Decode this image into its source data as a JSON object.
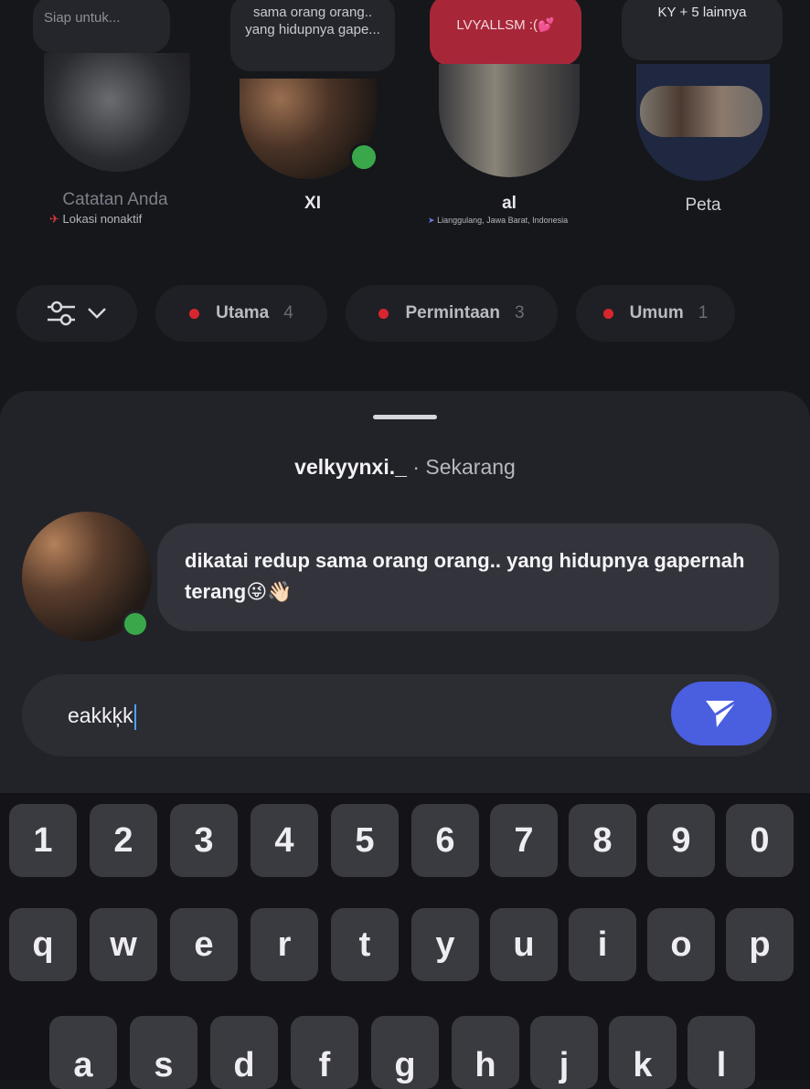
{
  "notes": [
    {
      "bubble": "Siap untuk...",
      "name": "Catatan Anda",
      "sub": "Lokasi nonaktif"
    },
    {
      "bubble": "sama orang orang.. yang hidupnya gape...",
      "name": "XI"
    },
    {
      "bubble": "LVYALLSM :(💕",
      "name": "al",
      "sub": "Lianggulang, Jawa Barat, Indonesia"
    },
    {
      "bubble": "KY + 5 lainnya",
      "name": "Peta"
    }
  ],
  "filters": [
    {
      "label": "Utama",
      "count": "4"
    },
    {
      "label": "Permintaan",
      "count": "3"
    },
    {
      "label": "Umum",
      "count": "1"
    }
  ],
  "sheet": {
    "username": "velkyynxi._",
    "separator": "·",
    "time": "Sekarang",
    "message": "dikatai redup sama orang orang.. yang hidupnya gapernah terang😜👋🏻",
    "reply_value": "eakkķk"
  },
  "keyboard": {
    "row1": [
      "1",
      "2",
      "3",
      "4",
      "5",
      "6",
      "7",
      "8",
      "9",
      "0"
    ],
    "row2": [
      "q",
      "w",
      "e",
      "r",
      "t",
      "y",
      "u",
      "i",
      "o",
      "p"
    ],
    "row3": [
      "a",
      "s",
      "d",
      "f",
      "g",
      "h",
      "j",
      "k",
      "l"
    ]
  },
  "colors": {
    "background": "#16171b",
    "accent_send": "#4a5ee0",
    "online": "#3aa84a",
    "note_highlight": "#c12b43",
    "unread_dot": "#d8262f"
  }
}
